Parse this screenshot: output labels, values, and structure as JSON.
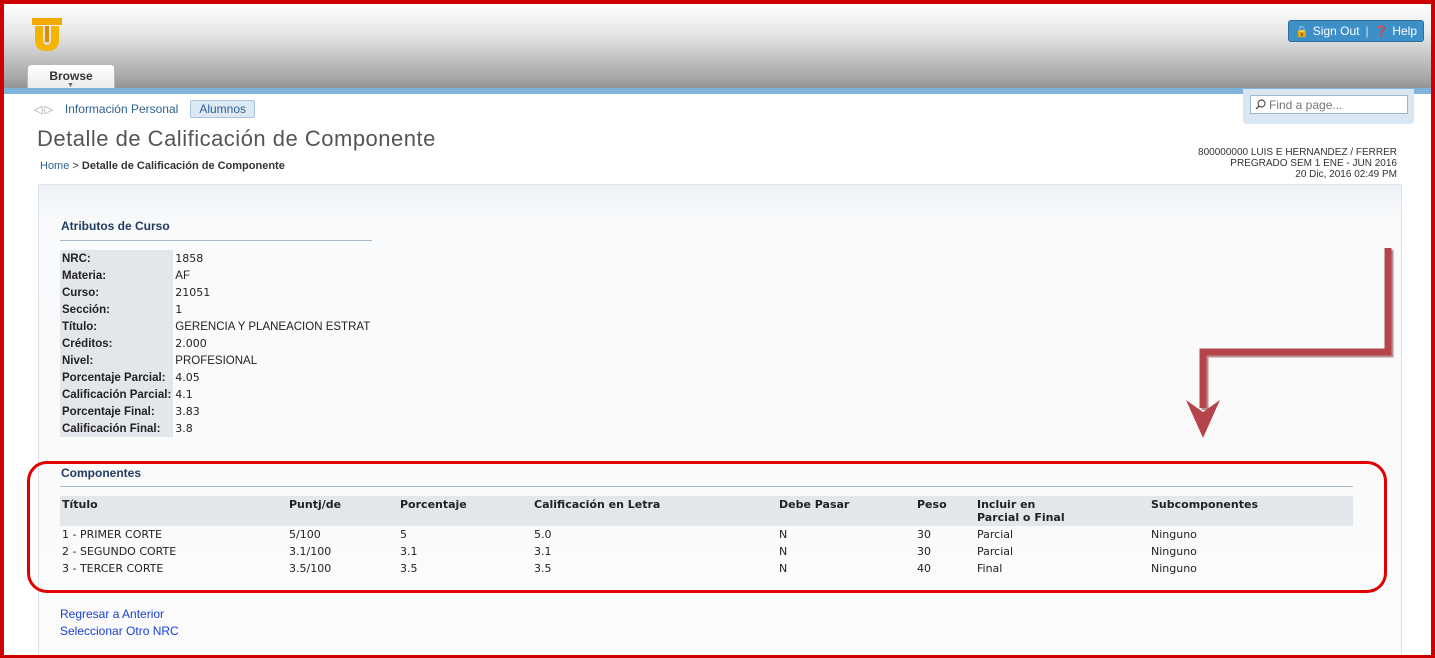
{
  "header": {
    "sign_out": "Sign Out",
    "separator": "|",
    "help": "Help",
    "browse_tab": "Browse"
  },
  "nav": {
    "link": "Información Personal",
    "tab": "Alumnos"
  },
  "search": {
    "placeholder": "Find a page..."
  },
  "page": {
    "title": "Detalle de Calificación de Componente",
    "breadcrumb_home": "Home",
    "breadcrumb_sep": ">",
    "breadcrumb_current": "Detalle de Calificación de Componente"
  },
  "user": {
    "line1": "800000000 LUIS E HERNANDEZ / FERRER",
    "line2": "PREGRADO SEM 1 ENE - JUN 2016",
    "line3": "20 Dic, 2016 02:49 PM"
  },
  "attributes": {
    "title": "Atributos de Curso",
    "rows": [
      {
        "label": "NRC:",
        "value": "1858"
      },
      {
        "label": "Materia:",
        "value": "AF"
      },
      {
        "label": "Curso:",
        "value": "21051"
      },
      {
        "label": "Sección:",
        "value": "1"
      },
      {
        "label": "Título:",
        "value": "GERENCIA Y PLANEACION ESTRAT"
      },
      {
        "label": "Créditos:",
        "value": "2.000"
      },
      {
        "label": "Nivel:",
        "value": "PROFESIONAL"
      },
      {
        "label": "Porcentaje Parcial:",
        "value": "4.05"
      },
      {
        "label": "Calificación Parcial:",
        "value": "4.1"
      },
      {
        "label": "Porcentaje Final:",
        "value": "3.83"
      },
      {
        "label": "Calificación Final:",
        "value": "3.8"
      }
    ]
  },
  "components": {
    "title": "Componentes",
    "headers": [
      "Título",
      "Puntj/de",
      "Porcentaje",
      "Calificación en Letra",
      "Debe Pasar",
      "Peso",
      "Incluir en",
      "Parcial o Final",
      "Subcomponentes"
    ],
    "rows": [
      [
        "1 - PRIMER CORTE",
        "5/100",
        "5",
        "5.0",
        "N",
        "30",
        "Parcial",
        "Ninguno"
      ],
      [
        "2 - SEGUNDO CORTE",
        "3.1/100",
        "3.1",
        "3.1",
        "N",
        "30",
        "Parcial",
        "Ninguno"
      ],
      [
        "3 - TERCER CORTE",
        "3.5/100",
        "3.5",
        "3.5",
        "N",
        "40",
        "Final",
        "Ninguno"
      ]
    ]
  },
  "links": {
    "back": "Regresar a Anterior",
    "other_nrc": "Seleccionar Otro NRC"
  },
  "colors": {
    "annotation_red": "#e00000",
    "arrow_red": "#b5454a",
    "link_blue": "#1a3fd6",
    "header_blue": "#3d8fc8"
  }
}
